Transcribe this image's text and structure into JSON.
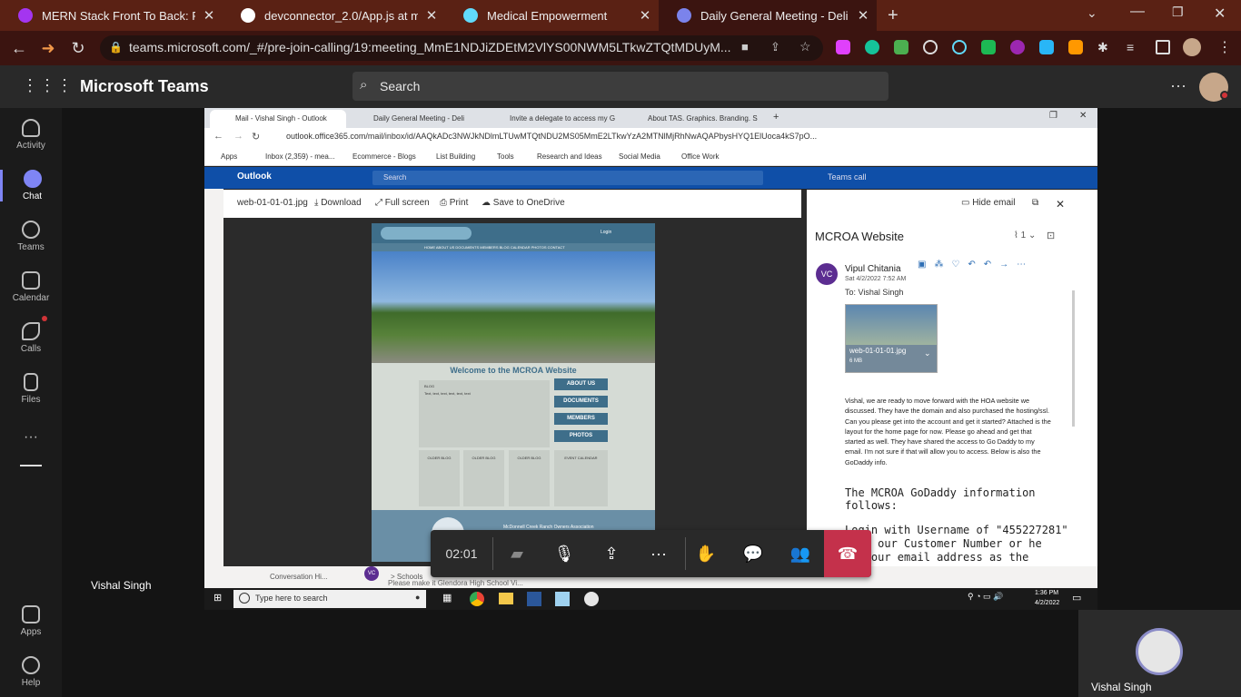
{
  "browser": {
    "tabs": [
      {
        "title": "MERN Stack Front To Back: Full St",
        "icon_color": "#a435f0"
      },
      {
        "title": "devconnector_2.0/App.js at mast",
        "icon_color": "#ffffff"
      },
      {
        "title": "Medical Empowerment",
        "icon_color": "#61dafb"
      },
      {
        "title": "Daily General Meeting - Deli",
        "icon_color": "#7b83eb"
      }
    ],
    "url": "teams.microsoft.com/_#/pre-join-calling/19:meeting_MmE1NDJiZDEtM2VlYS00NWM5LTkwZTQtMDUyM..."
  },
  "teams": {
    "title": "Microsoft Teams",
    "search_placeholder": "Search",
    "rail": [
      "Activity",
      "Chat",
      "Teams",
      "Calendar",
      "Calls",
      "Files",
      "Apps",
      "Help"
    ],
    "presenter_name": "Vishal Singh",
    "self_name": "Vishal Singh",
    "call_timer": "02:01"
  },
  "shared": {
    "tabs": [
      "Mail - Vishal Singh - Outlook",
      "Daily General Meeting - Deli",
      "Invite a delegate to access my G",
      "About TAS. Graphics. Branding. S"
    ],
    "url": "outlook.office365.com/mail/inbox/id/AAQkADc3NWJkNDlmLTUwMTQtNDU2MS05MmE2LTkwYzA2MTNlMjRhNwAQAPbysHYQ1ElUoca4kS7pO...",
    "bookmarks": [
      "Apps",
      "Inbox (2,359) - mea...",
      "Ecommerce - Blogs",
      "List Building",
      "Tools",
      "Research and Ideas",
      "Social Media",
      "Office Work"
    ],
    "outlook_label": "Outlook",
    "outlook_search": "Search",
    "teams_call": "Teams call",
    "viewer": {
      "filename": "web-01-01-01.jpg",
      "download": "Download",
      "fullscreen": "Full screen",
      "print": "Print",
      "save": "Save to OneDrive",
      "hide_email": "Hide email"
    },
    "mock": {
      "welcome": "Welcome to the MCROA Website",
      "blog": "BLOG",
      "blog_text": "Text, text, text, text, text, text",
      "buttons": [
        "ABOUT US",
        "DOCUMENTS",
        "MEMBERS",
        "PHOTOS"
      ],
      "older": [
        "OLDER BLOG",
        "OLDER BLOG",
        "OLDER BLOG"
      ],
      "event": "EVENT CALENDAR",
      "footer": "McDonnell Creek Ranch Owners Association",
      "nav": "HOME  ABOUT US  DOCUMENTS  MEMBERS  BLOG  CALENDAR  PHOTOS  CONTACT",
      "login": "Login"
    },
    "email": {
      "subject": "MCROA Website",
      "attach_count": "1",
      "initials": "VC",
      "sender": "Vipul Chitania",
      "date": "Sat 4/2/2022 7:52 AM",
      "to": "To:  Vishal Singh",
      "attachment_name": "web-01-01-01.jpg",
      "attachment_size": "6 MB",
      "body": "Vishal, we are ready to move forward with the HOA website we discussed.  They have the domain and also purchased the hosting/ssl.  Can you please get into the account and get it started?  Attached is the layout for the home page for now.  Please go ahead and get that started as well.  They have shared the access to Go Daddy to my email. I'm not sure if that will allow you to access.  Below is also the GoDaddy info.",
      "heading": "The MCROA GoDaddy information follows:",
      "login_line": "Login with Username of \"455227281\"",
      "line2": "h is our Customer Number or he",
      "line3": "use our email address as the"
    },
    "behind": {
      "conv": "Conversation Hi...",
      "schools": "> Schools",
      "please": "Please make it Glendora High School Vi..."
    },
    "taskbar": {
      "search": "Type here to search",
      "time": "1:36 PM",
      "date": "4/2/2022"
    }
  }
}
